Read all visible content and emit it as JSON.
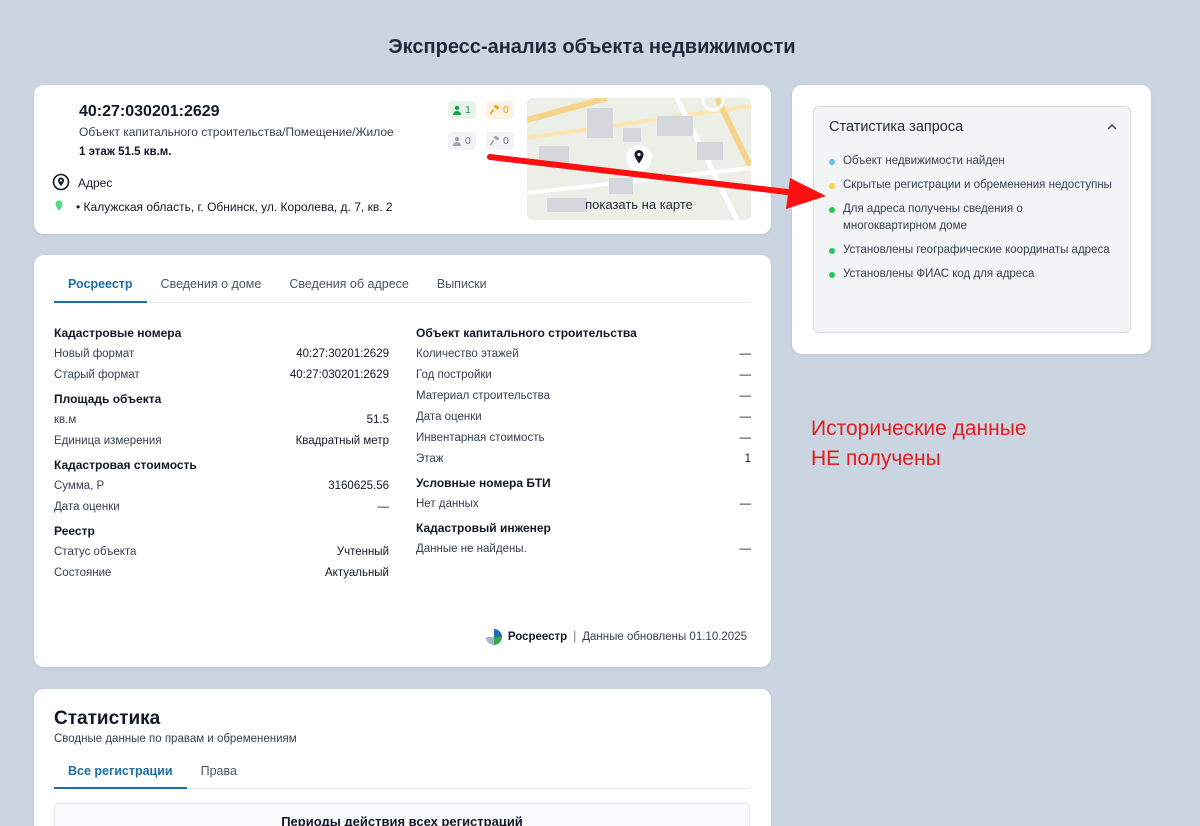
{
  "page": {
    "title": "Экспресс-анализ объекта недвижимости"
  },
  "object": {
    "cadastral_number": "40:27:030201:2629",
    "type": "Объект капитального строительства/Помещение/Жилое",
    "floor_area": "1 этаж  51.5 кв.м.",
    "address_label": "Адрес",
    "address": "• Калужская область, г. Обнинск, ул. Королева, д. 7, кв. 2",
    "badges": [
      {
        "icon": "person-icon",
        "value": "1",
        "color": "#16a34a",
        "bg": "#e6f4ea"
      },
      {
        "icon": "hammer-icon",
        "value": "0",
        "color": "#f59e0b",
        "bg": "#fdf2e3"
      },
      {
        "icon": "person-icon",
        "value": "0",
        "color": "#6b7280",
        "bg": "#f1f3f5"
      },
      {
        "icon": "hammer-icon",
        "value": "0",
        "color": "#6b7280",
        "bg": "#f1f3f5"
      }
    ],
    "map_button": "показать на карте"
  },
  "request_stats": {
    "title": "Статистика запроса",
    "items": [
      {
        "text": "Объект недвижимости найден",
        "color": "#60c3e8"
      },
      {
        "text": "Скрытые регистрации и обременения недоступны",
        "color": "#f5d34a"
      },
      {
        "text": "Для адреса получены сведения о многоквартирном доме",
        "color": "#22c55e"
      },
      {
        "text": "Установлены географические координаты адреса",
        "color": "#22c55e"
      },
      {
        "text": "Установлены ФИАС код для адреса",
        "color": "#22c55e"
      }
    ]
  },
  "annotation": {
    "line1": "Исторические данные",
    "line2": "НЕ получены",
    "color": "#e11d1d"
  },
  "tabs": [
    "Росреестр",
    "Сведения о доме",
    "Сведения об адресе",
    "Выписки"
  ],
  "active_tab": "Росреестр",
  "left_sections": [
    {
      "title": "Кадастровые номера",
      "rows": [
        [
          "Новый формат",
          "40:27:30201:2629"
        ],
        [
          "Старый формат",
          "40:27:030201:2629"
        ]
      ]
    },
    {
      "title": "Площадь объекта",
      "rows": [
        [
          "кв.м",
          "51.5"
        ],
        [
          "Единица измерения",
          "Квадратный метр"
        ]
      ]
    },
    {
      "title": "Кадастровая стоимость",
      "rows": [
        [
          "Сумма, Р",
          "3160625.56"
        ],
        [
          "Дата оценки",
          "—"
        ]
      ]
    },
    {
      "title": "Реестр",
      "rows": [
        [
          "Статус объекта",
          "Учтенный"
        ],
        [
          "Состояние",
          "Актуальный"
        ]
      ]
    }
  ],
  "right_sections": [
    {
      "title": "Объект капитального строительства",
      "rows": [
        [
          "Количество этажей",
          "—"
        ],
        [
          "Год постройки",
          "—"
        ],
        [
          "Материал строительства",
          "—"
        ],
        [
          "Дата оценки",
          "—"
        ],
        [
          "Инвентарная стоимость",
          "—"
        ],
        [
          "Этаж",
          "1"
        ]
      ]
    },
    {
      "title": "Условные номера БТИ",
      "rows": [
        [
          "Нет данных",
          "—"
        ]
      ]
    },
    {
      "title": "Кадастровый инженер",
      "rows": [
        [
          "Данные не найдены.",
          "—"
        ]
      ]
    }
  ],
  "source": {
    "brand": "Росреестр",
    "separator": "|",
    "updated": "Данные обновлены 01.10.2025"
  },
  "statistics": {
    "title": "Статистика",
    "subtitle": "Сводные данные по правам и обременениям",
    "tabs": [
      "Все регистрации",
      "Права"
    ],
    "active_tab": "Все регистрации",
    "panel_title": "Периоды действия всех регистраций"
  }
}
